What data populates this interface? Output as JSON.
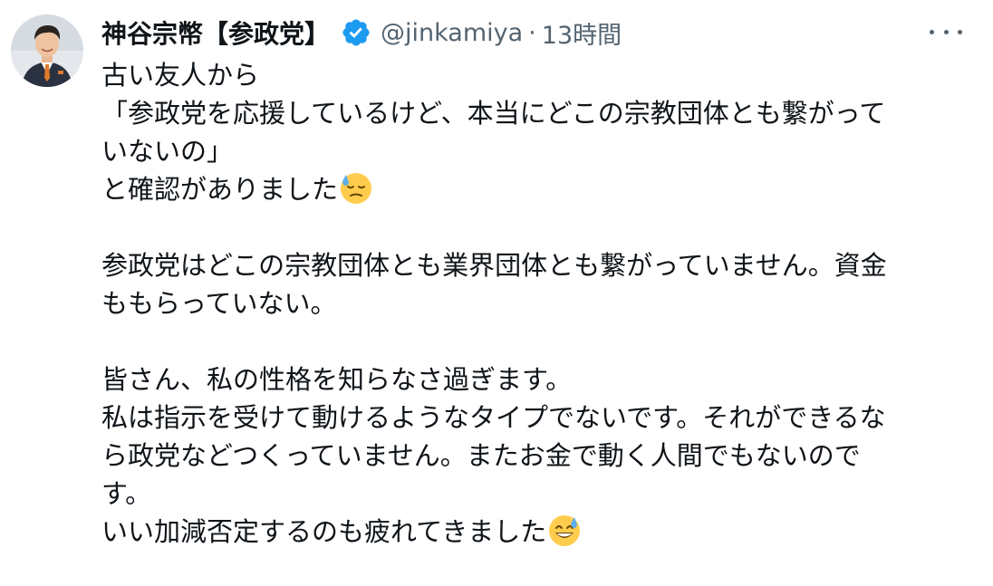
{
  "tweet": {
    "author": {
      "display_name": "神谷宗幣【参政党】",
      "handle": "@jinkamiya",
      "verified_icon": "verified-badge-icon",
      "avatar_icon": "profile-avatar"
    },
    "separator": "·",
    "timestamp": "13時間",
    "more_icon": "more-options-icon",
    "text": {
      "p1": {
        "l1": "古い友人から",
        "l2": "「参政党を応援しているけど、本当にどこの宗教団体とも繋がって",
        "l3": "いないの」",
        "l4": "と確認がありました",
        "l4_emoji": "downcast-face-with-sweat-emoji"
      },
      "p2": {
        "l1": "参政党はどこの宗教団体とも業界団体とも繋がっていません。資金",
        "l2": "ももらっていない。"
      },
      "p3": {
        "l1": "皆さん、私の性格を知らなさ過ぎます。",
        "l2": "私は指示を受けて動けるようなタイプでないです。それができるな",
        "l3": "ら政党などつくっていません。またお金で動く人間でもないので",
        "l4": "す。",
        "l5": "いい加減否定するのも疲れてきました",
        "l5_emoji": "grinning-face-with-sweat-emoji"
      }
    },
    "colors": {
      "text": "#0f1419",
      "secondary": "#536471",
      "verified": "#1d9bf0",
      "emoji": "#ffcc4d"
    }
  }
}
